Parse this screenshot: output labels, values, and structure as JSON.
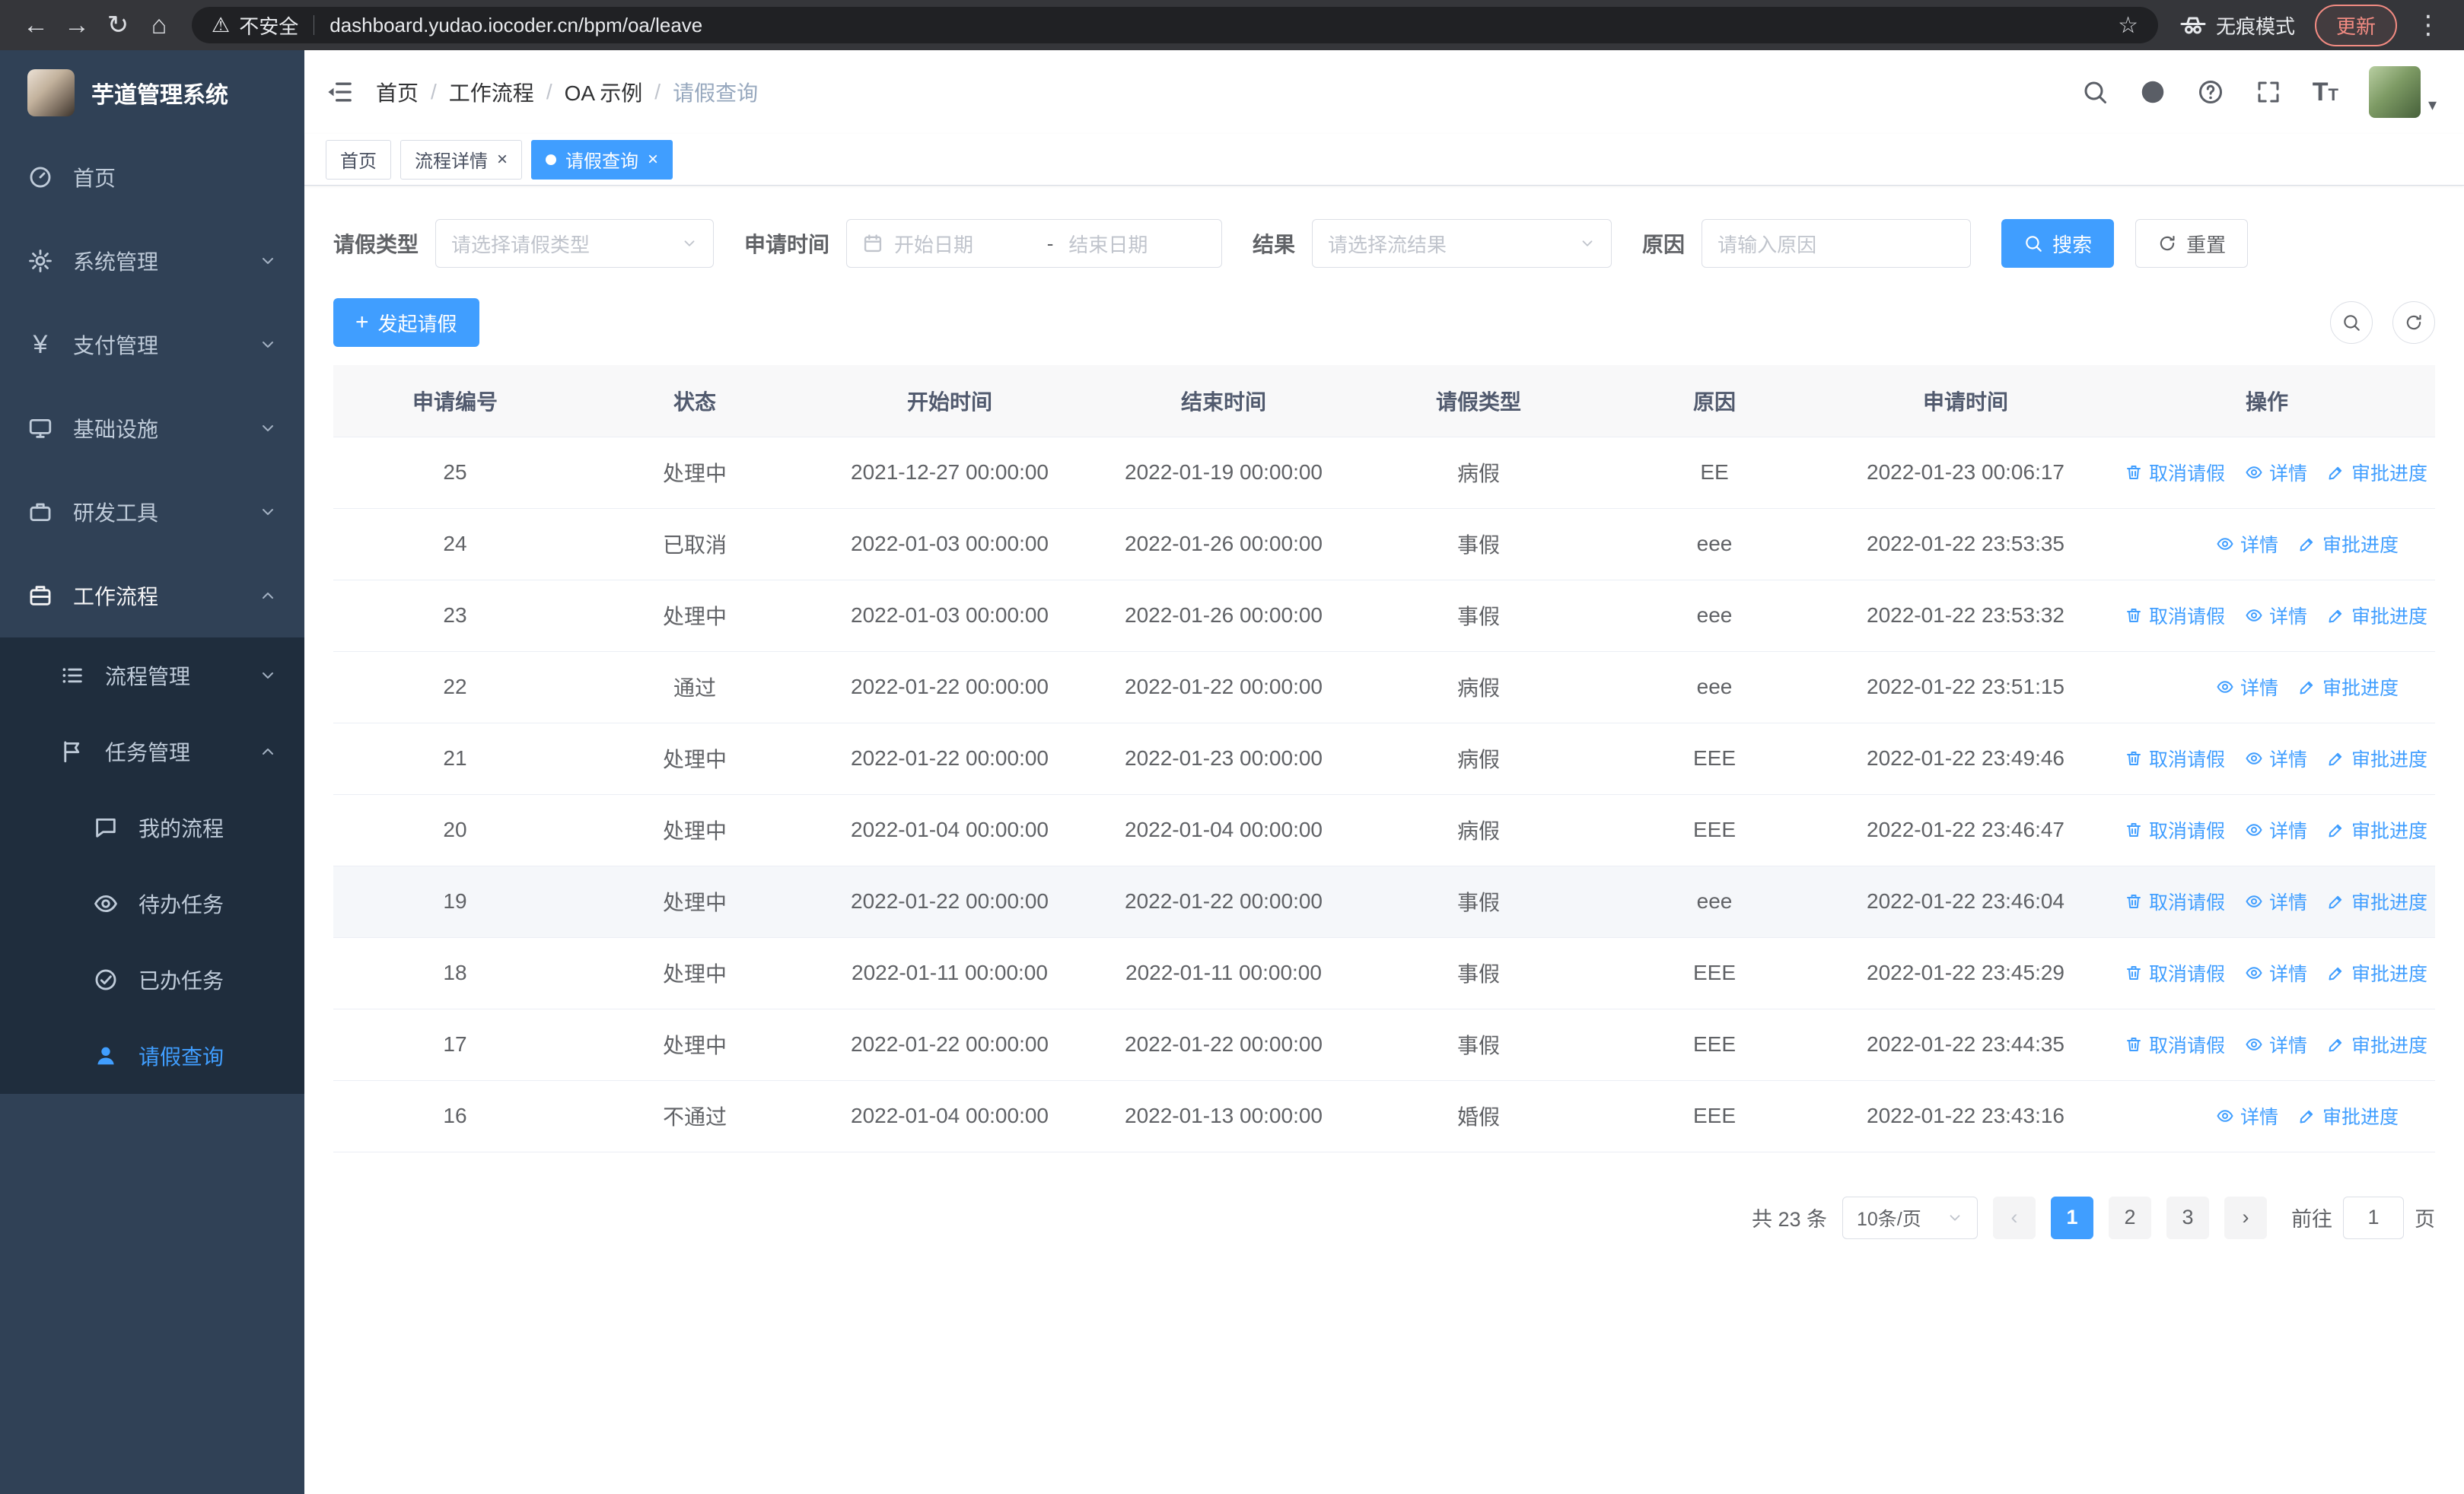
{
  "browser": {
    "security_warning": "不安全",
    "url": "dashboard.yudao.iocoder.cn/bpm/oa/leave",
    "incognito_label": "无痕模式",
    "update_label": "更新"
  },
  "icons": {
    "back": "←",
    "forward": "→",
    "reload": "↻",
    "home": "⌂",
    "warning": "⚠",
    "star": "☆",
    "menu_dots": "⋮",
    "caret_down": "▾",
    "yen": "¥",
    "plus": "+",
    "close": "×",
    "prev": "‹",
    "next": "›"
  },
  "sidebar": {
    "logo_title": "芋道管理系统",
    "items": [
      {
        "label": "首页"
      },
      {
        "label": "系统管理"
      },
      {
        "label": "支付管理"
      },
      {
        "label": "基础设施"
      },
      {
        "label": "研发工具"
      },
      {
        "label": "工作流程"
      }
    ],
    "workflow_children": [
      {
        "label": "流程管理"
      },
      {
        "label": "任务管理"
      }
    ],
    "task_children": [
      {
        "label": "我的流程"
      },
      {
        "label": "待办任务"
      },
      {
        "label": "已办任务"
      },
      {
        "label": "请假查询"
      }
    ]
  },
  "header": {
    "breadcrumb": [
      "首页",
      "工作流程",
      "OA 示例",
      "请假查询"
    ],
    "separator": "/"
  },
  "tabs": [
    {
      "label": "首页"
    },
    {
      "label": "流程详情"
    },
    {
      "label": "请假查询"
    }
  ],
  "filters": {
    "leave_type_label": "请假类型",
    "leave_type_placeholder": "请选择请假类型",
    "apply_time_label": "申请时间",
    "start_date_placeholder": "开始日期",
    "range_separator": "-",
    "end_date_placeholder": "结束日期",
    "result_label": "结果",
    "result_placeholder": "请选择流结果",
    "reason_label": "原因",
    "reason_placeholder": "请输入原因",
    "search_label": "搜索",
    "reset_label": "重置"
  },
  "toolbar": {
    "create_label": "发起请假"
  },
  "table": {
    "columns": [
      "申请编号",
      "状态",
      "开始时间",
      "结束时间",
      "请假类型",
      "原因",
      "申请时间",
      "操作"
    ],
    "action_labels": {
      "cancel": "取消请假",
      "detail": "详情",
      "progress": "审批进度"
    },
    "rows": [
      {
        "id": "25",
        "status": "处理中",
        "start": "2021-12-27 00:00:00",
        "end": "2022-01-19 00:00:00",
        "type": "病假",
        "reason": "EE",
        "applied": "2022-01-23 00:06:17",
        "actions": [
          "cancel",
          "detail",
          "progress"
        ]
      },
      {
        "id": "24",
        "status": "已取消",
        "start": "2022-01-03 00:00:00",
        "end": "2022-01-26 00:00:00",
        "type": "事假",
        "reason": "eee",
        "applied": "2022-01-22 23:53:35",
        "actions": [
          "detail",
          "progress"
        ]
      },
      {
        "id": "23",
        "status": "处理中",
        "start": "2022-01-03 00:00:00",
        "end": "2022-01-26 00:00:00",
        "type": "事假",
        "reason": "eee",
        "applied": "2022-01-22 23:53:32",
        "actions": [
          "cancel",
          "detail",
          "progress"
        ]
      },
      {
        "id": "22",
        "status": "通过",
        "start": "2022-01-22 00:00:00",
        "end": "2022-01-22 00:00:00",
        "type": "病假",
        "reason": "eee",
        "applied": "2022-01-22 23:51:15",
        "actions": [
          "detail",
          "progress"
        ]
      },
      {
        "id": "21",
        "status": "处理中",
        "start": "2022-01-22 00:00:00",
        "end": "2022-01-23 00:00:00",
        "type": "病假",
        "reason": "EEE",
        "applied": "2022-01-22 23:49:46",
        "actions": [
          "cancel",
          "detail",
          "progress"
        ]
      },
      {
        "id": "20",
        "status": "处理中",
        "start": "2022-01-04 00:00:00",
        "end": "2022-01-04 00:00:00",
        "type": "病假",
        "reason": "EEE",
        "applied": "2022-01-22 23:46:47",
        "actions": [
          "cancel",
          "detail",
          "progress"
        ]
      },
      {
        "id": "19",
        "status": "处理中",
        "start": "2022-01-22 00:00:00",
        "end": "2022-01-22 00:00:00",
        "type": "事假",
        "reason": "eee",
        "applied": "2022-01-22 23:46:04",
        "actions": [
          "cancel",
          "detail",
          "progress"
        ],
        "hover": true
      },
      {
        "id": "18",
        "status": "处理中",
        "start": "2022-01-11 00:00:00",
        "end": "2022-01-11 00:00:00",
        "type": "事假",
        "reason": "EEE",
        "applied": "2022-01-22 23:45:29",
        "actions": [
          "cancel",
          "detail",
          "progress"
        ]
      },
      {
        "id": "17",
        "status": "处理中",
        "start": "2022-01-22 00:00:00",
        "end": "2022-01-22 00:00:00",
        "type": "事假",
        "reason": "EEE",
        "applied": "2022-01-22 23:44:35",
        "actions": [
          "cancel",
          "detail",
          "progress"
        ]
      },
      {
        "id": "16",
        "status": "不通过",
        "start": "2022-01-04 00:00:00",
        "end": "2022-01-13 00:00:00",
        "type": "婚假",
        "reason": "EEE",
        "applied": "2022-01-22 23:43:16",
        "actions": [
          "detail",
          "progress"
        ]
      }
    ]
  },
  "pagination": {
    "total_text": "共 23 条",
    "page_size": "10条/页",
    "pages": [
      "1",
      "2",
      "3"
    ],
    "current_page": "1",
    "goto_label": "前往",
    "goto_value": "1",
    "unit_label": "页"
  },
  "colors": {
    "accent": "#409eff",
    "sidebar_bg": "#304156",
    "submenu_bg": "#1f2d3d",
    "update_badge": "#f28b82"
  }
}
